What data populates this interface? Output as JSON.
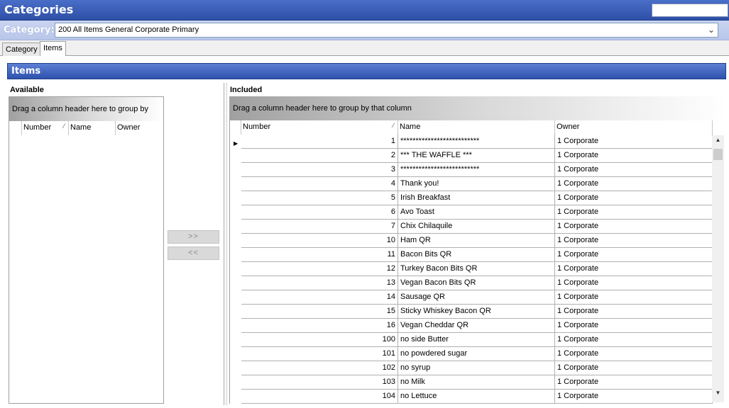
{
  "window": {
    "title": "Categories"
  },
  "category": {
    "label": "Category:",
    "value": "200 All Items General Corporate Primary"
  },
  "tabs": [
    {
      "label": "Category"
    },
    {
      "label": "Items"
    }
  ],
  "section": {
    "title": "Items"
  },
  "available": {
    "label": "Available",
    "group_hint": "Drag a column header here to group by",
    "columns": [
      "Number",
      "Name",
      "Owner"
    ]
  },
  "buttons": {
    "add": ">>",
    "remove": "<<"
  },
  "included": {
    "label": "Included",
    "group_hint": "Drag a column header here to group by that column",
    "columns": [
      "Number",
      "Name",
      "Owner"
    ],
    "rows": [
      {
        "number": "1",
        "name": "**************************",
        "owner": "1  Corporate"
      },
      {
        "number": "2",
        "name": "*** THE WAFFLE ***",
        "owner": "1  Corporate"
      },
      {
        "number": "3",
        "name": "**************************",
        "owner": "1  Corporate"
      },
      {
        "number": "4",
        "name": "Thank you!",
        "owner": "1  Corporate"
      },
      {
        "number": "5",
        "name": "Irish Breakfast",
        "owner": "1  Corporate"
      },
      {
        "number": "6",
        "name": "Avo Toast",
        "owner": "1  Corporate"
      },
      {
        "number": "7",
        "name": "Chix Chilaquile",
        "owner": "1  Corporate"
      },
      {
        "number": "10",
        "name": "Ham QR",
        "owner": "1  Corporate"
      },
      {
        "number": "11",
        "name": "Bacon Bits QR",
        "owner": "1  Corporate"
      },
      {
        "number": "12",
        "name": "Turkey Bacon Bits QR",
        "owner": "1  Corporate"
      },
      {
        "number": "13",
        "name": "Vegan Bacon Bits QR",
        "owner": "1  Corporate"
      },
      {
        "number": "14",
        "name": "Sausage QR",
        "owner": "1  Corporate"
      },
      {
        "number": "15",
        "name": "Sticky Whiskey Bacon QR",
        "owner": "1  Corporate"
      },
      {
        "number": "16",
        "name": "Vegan Cheddar QR",
        "owner": "1  Corporate"
      },
      {
        "number": "100",
        "name": "no side Butter",
        "owner": "1  Corporate"
      },
      {
        "number": "101",
        "name": "no powdered sugar",
        "owner": "1  Corporate"
      },
      {
        "number": "102",
        "name": "no syrup",
        "owner": "1  Corporate"
      },
      {
        "number": "103",
        "name": "no Milk",
        "owner": "1  Corporate"
      },
      {
        "number": "104",
        "name": "no Lettuce",
        "owner": "1  Corporate"
      }
    ]
  }
}
